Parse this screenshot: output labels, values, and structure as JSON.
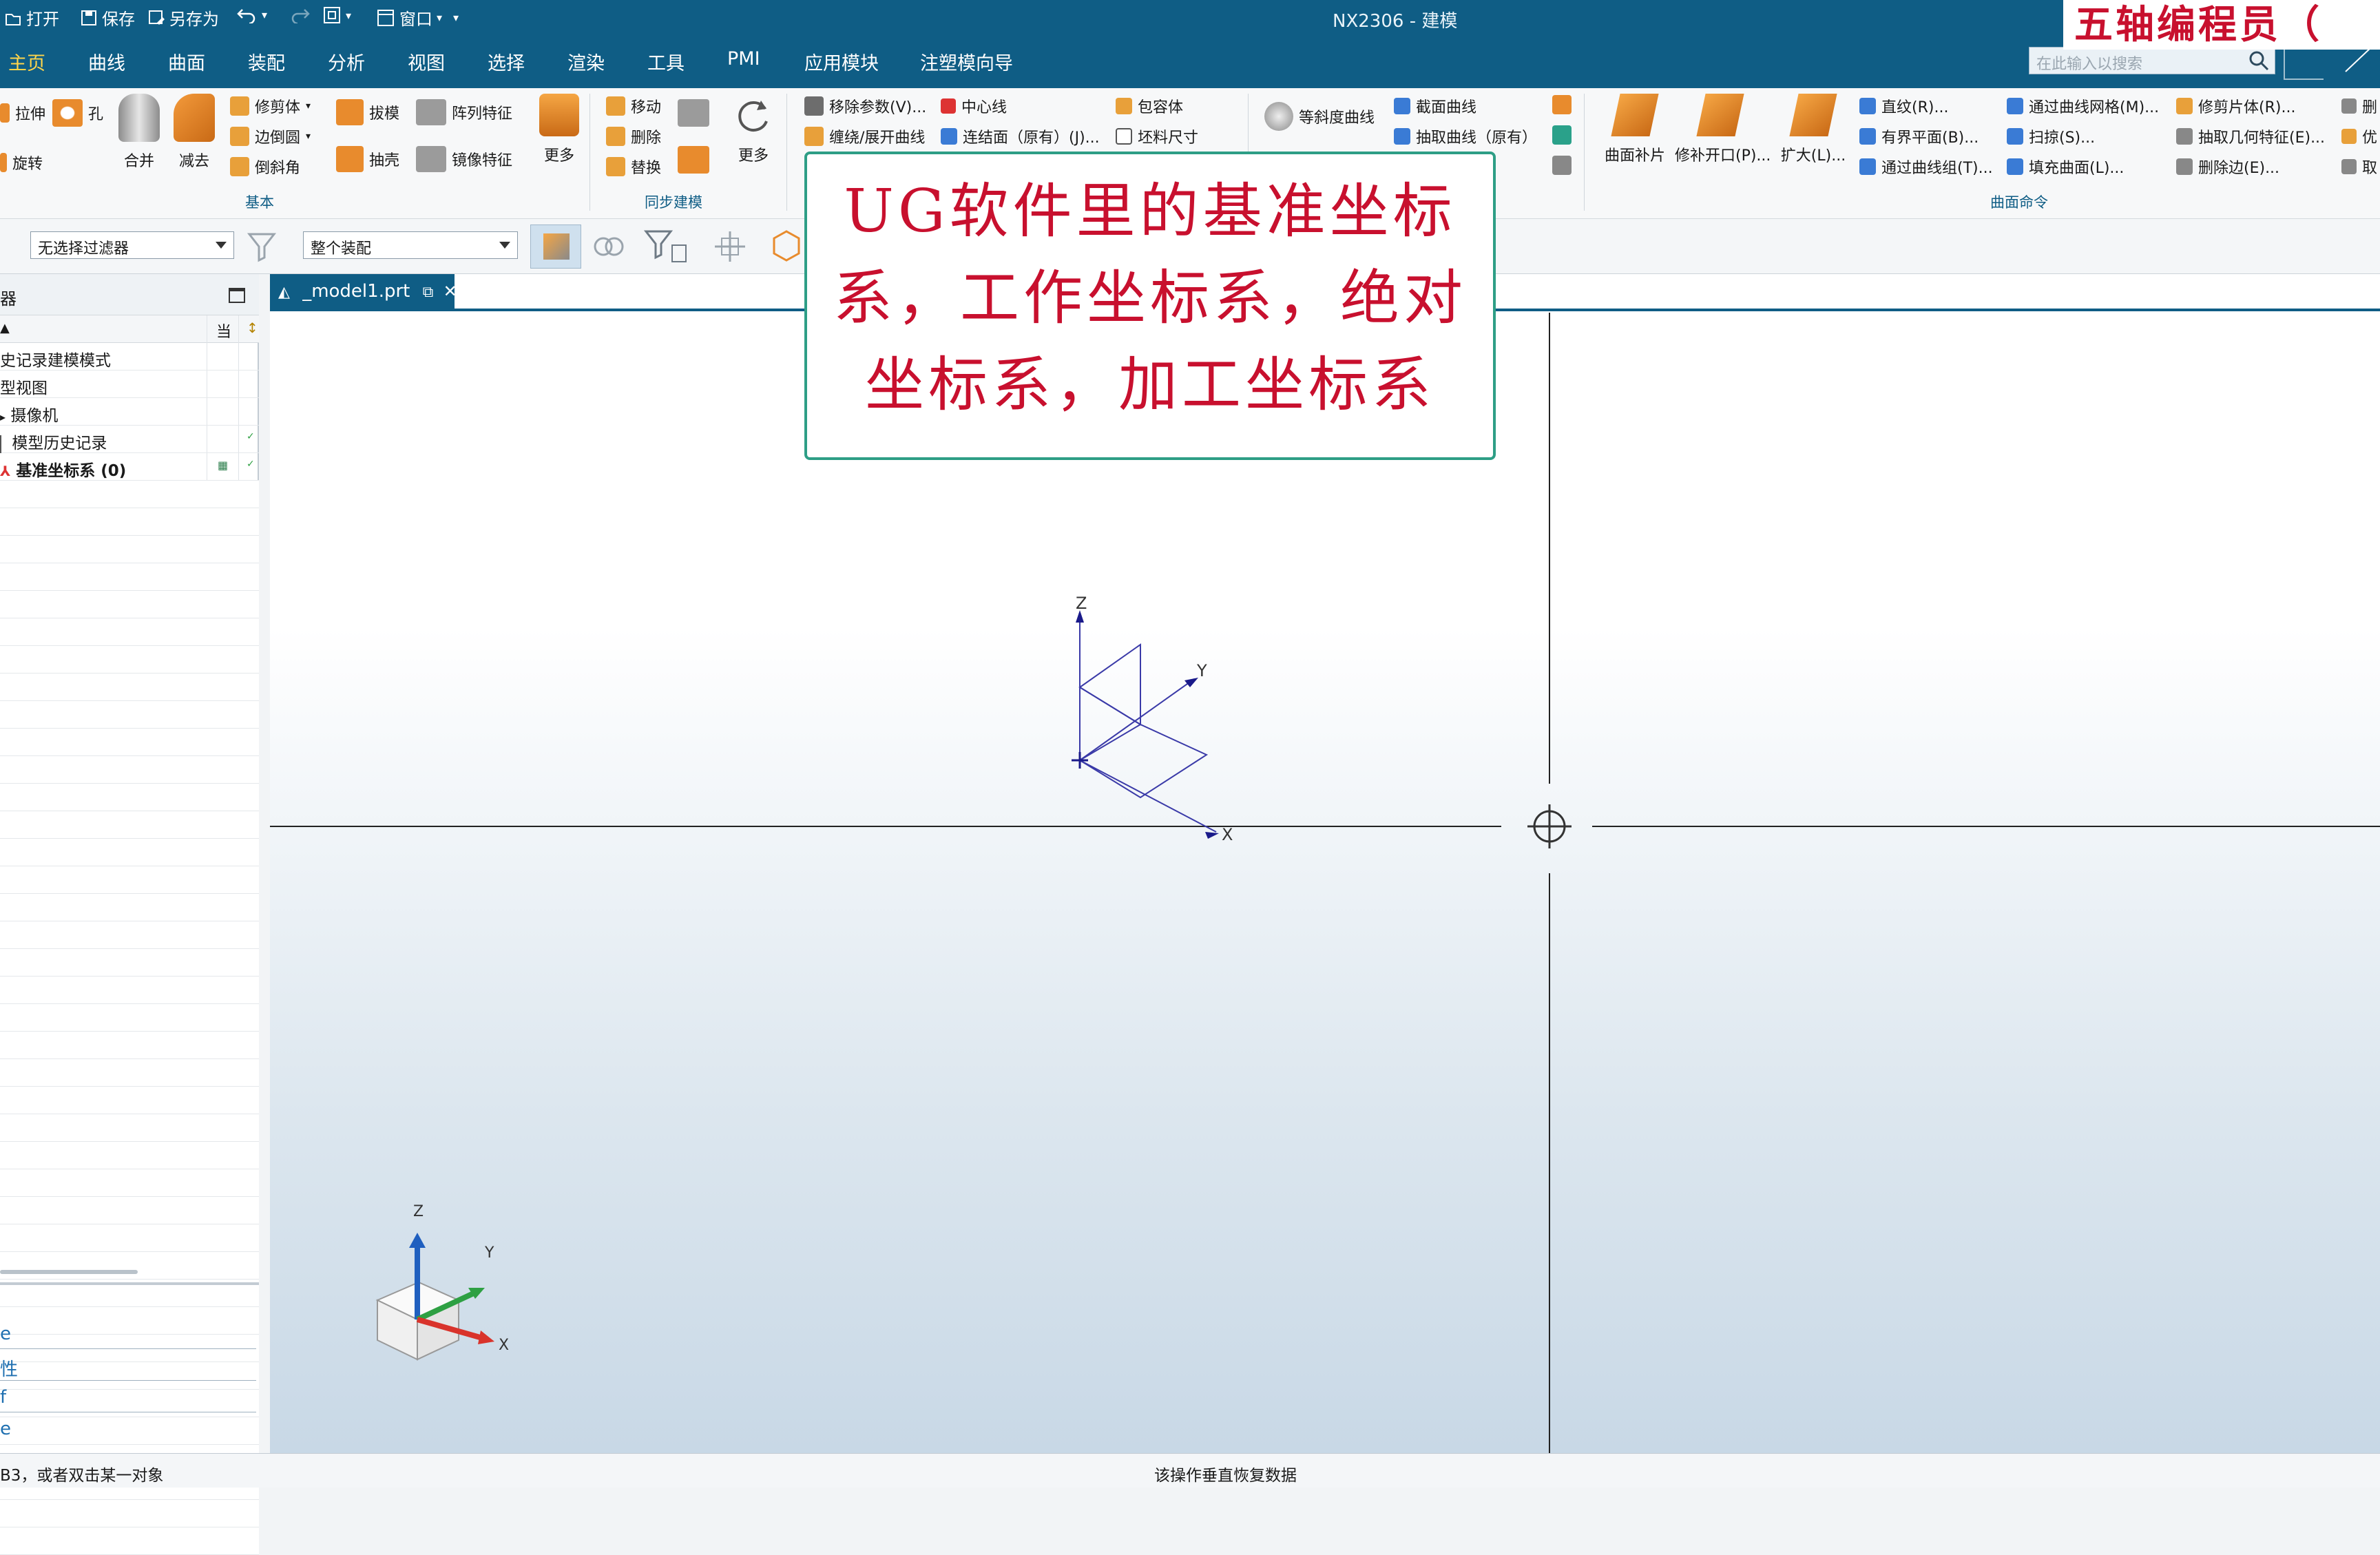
{
  "titlebar": {
    "open": "打开",
    "save": "保存",
    "save_as": "另存为",
    "window": "窗口",
    "app_title": "NX2306 - 建模",
    "brand": "五轴编程员（",
    "colors": {
      "bar": "#0f5d85",
      "brand_text": "#c8102e"
    }
  },
  "menu": {
    "tabs": [
      "主页",
      "曲线",
      "曲面",
      "装配",
      "分析",
      "视图",
      "选择",
      "渲染",
      "工具",
      "PMI",
      "应用模块",
      "注塑模向导"
    ],
    "active": "主页",
    "search_placeholder": "在此输入以搜索"
  },
  "ribbon": {
    "basic": {
      "extrude": "拉伸",
      "hole": "孔",
      "revolve": "旋转",
      "unite": "合并",
      "subtract": "减去",
      "trim_body": "修剪体",
      "edge_blend": "边倒圆",
      "chamfer": "倒斜角",
      "draft": "拔模",
      "shell": "抽壳",
      "pattern_feature": "阵列特征",
      "mirror_feature": "镜像特征",
      "more": "更多",
      "group_label": "基本"
    },
    "sync": {
      "move": "移动",
      "delete": "删除",
      "replace": "替换",
      "more": "更多",
      "group_label": "同步建模"
    },
    "curve": {
      "remove_params": "移除参数(V)...",
      "centerline": "中心线",
      "bounding_body": "包容体",
      "wrap_unwrap": "缠绕/展开曲线",
      "join_face": "连结面（原有）(J)...",
      "stock_size": "坯料尺寸",
      "isoparametric": "等斜度曲线",
      "section_curve": "截面曲线",
      "extract_curve": "抽取曲线（原有）"
    },
    "surface": {
      "patch": "曲面补片",
      "trim_opening": "修补开口(P)...",
      "enlarge": "扩大(L)...",
      "ruled": "直纹(R)...",
      "bounded_plane": "有界平面(B)...",
      "through_curves": "通过曲线组(T)...",
      "through_mesh": "通过曲线网格(M)...",
      "swept": "扫掠(S)...",
      "fill_surface": "填充曲面(L)...",
      "trim_sheet": "修剪片体(R)...",
      "extract_geometry": "抽取几何特征(E)...",
      "delete_edge": "删除边(E)...",
      "edge1": "删",
      "edge2": "优",
      "edge3": "取",
      "group_label": "曲面命令"
    }
  },
  "selbar": {
    "filter": "无选择过滤器",
    "scope": "整个装配"
  },
  "navigator": {
    "title": "器",
    "col_current": "当",
    "items": [
      {
        "label": "史记录建模模式"
      },
      {
        "label": "型视图"
      },
      {
        "label": "摄像机"
      },
      {
        "label": "模型历史记录"
      },
      {
        "label": "基准坐标系 (0)"
      }
    ],
    "bottom_links": [
      "e",
      "性",
      "f",
      "e"
    ]
  },
  "document": {
    "tab": "_model1.prt"
  },
  "callout": {
    "lines": [
      "UG软件里的基准坐标",
      "系，工作坐标系，绝对",
      "坐标系，加工坐标系"
    ]
  },
  "viewport": {
    "axis_labels": {
      "x": "X",
      "y": "Y",
      "z": "Z"
    },
    "triad_colors": {
      "x": "#d9332b",
      "y": "#2ea043",
      "z": "#1f5fbf"
    }
  },
  "status": {
    "left": "B3，或者双击某一对象",
    "center": "该操作垂直恢复数据"
  }
}
